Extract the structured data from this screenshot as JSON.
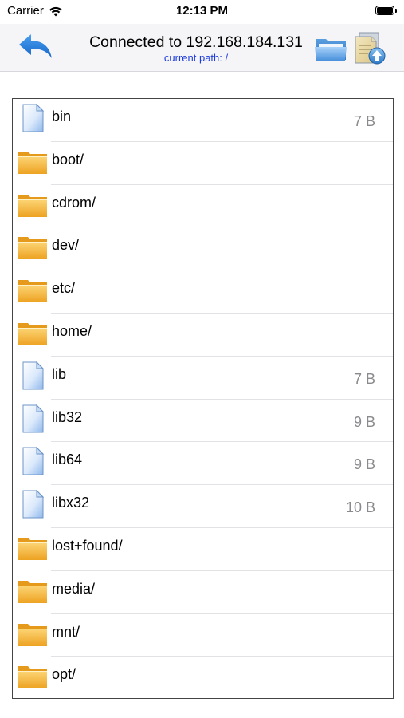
{
  "status_bar": {
    "carrier": "Carrier",
    "time": "12:13 PM"
  },
  "nav": {
    "title": "Connected to 192.168.184.131",
    "subtitle": "current path: /",
    "back_icon": "back-arrow-icon",
    "folder_icon": "folder-icon",
    "upload_icon": "upload-document-icon"
  },
  "colors": {
    "accent": "#1a73d9",
    "subtitle": "#1e3cdc",
    "size_text": "#8a8a8e",
    "folder": "#f5b02e"
  },
  "files": [
    {
      "name": "bin",
      "size": "7 B",
      "type": "file"
    },
    {
      "name": "boot/",
      "size": "",
      "type": "folder"
    },
    {
      "name": "cdrom/",
      "size": "",
      "type": "folder"
    },
    {
      "name": "dev/",
      "size": "",
      "type": "folder"
    },
    {
      "name": "etc/",
      "size": "",
      "type": "folder"
    },
    {
      "name": "home/",
      "size": "",
      "type": "folder"
    },
    {
      "name": "lib",
      "size": "7 B",
      "type": "file"
    },
    {
      "name": "lib32",
      "size": "9 B",
      "type": "file"
    },
    {
      "name": "lib64",
      "size": "9 B",
      "type": "file"
    },
    {
      "name": "libx32",
      "size": "10 B",
      "type": "file"
    },
    {
      "name": "lost+found/",
      "size": "",
      "type": "folder"
    },
    {
      "name": "media/",
      "size": "",
      "type": "folder"
    },
    {
      "name": "mnt/",
      "size": "",
      "type": "folder"
    },
    {
      "name": "opt/",
      "size": "",
      "type": "folder"
    }
  ]
}
